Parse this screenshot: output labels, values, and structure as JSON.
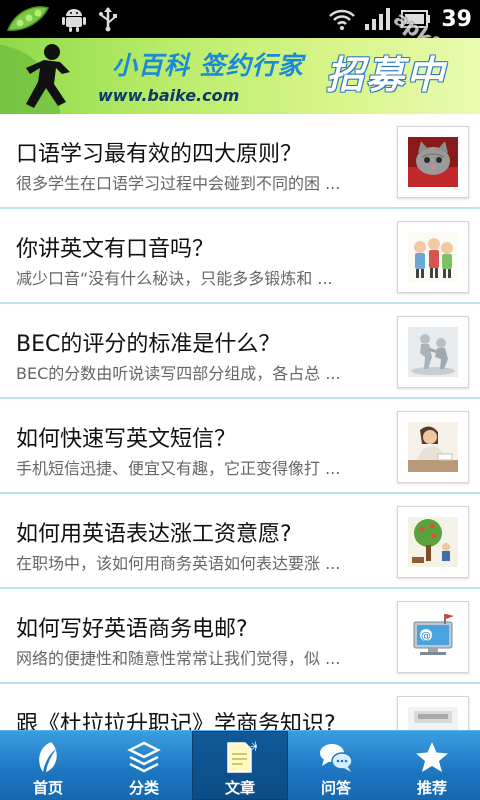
{
  "status_bar": {
    "time": "39",
    "watermark": "apk8.com",
    "icons": [
      "pea-pod-icon",
      "android-icon",
      "usb-icon",
      "wifi-icon",
      "signal-icon",
      "battery-icon"
    ]
  },
  "banner": {
    "slogan": "小百科 签约行家",
    "url": "www.baike.com",
    "recruit": "招募中"
  },
  "articles": [
    {
      "title": "口语学习最有效的四大原则？",
      "summary": "很多学生在口语学习过程中会碰到不同的困 ...",
      "thumb_icon": "kitten-thumb"
    },
    {
      "title": "你讲英文有口音吗？",
      "summary": "减少口音“没有什么秘诀，只能多多锻炼和 ...",
      "thumb_icon": "cartoon-people-thumb"
    },
    {
      "title": "BEC的评分的标准是什么？",
      "summary": "BEC的分数由听说读写四部分组成，各占总 ...",
      "thumb_icon": "figures-thumb"
    },
    {
      "title": "如何快速写英文短信？",
      "summary": "手机短信迅捷、便宜又有趣，它正变得像打 ...",
      "thumb_icon": "woman-desk-thumb"
    },
    {
      "title": "如何用英语表达涨工资意愿?",
      "summary": "在职场中，该如何用商务英语如何表达要涨 ...",
      "thumb_icon": "money-tree-thumb"
    },
    {
      "title": "如何写好英语商务电邮?",
      "summary": "网络的便捷性和随意性常常让我们觉得，似 ...",
      "thumb_icon": "email-computer-thumb"
    },
    {
      "title": "跟《杜拉拉升职记》学商务知识?",
      "summary": "",
      "thumb_icon": "book-cover-thumb"
    }
  ],
  "tabs": [
    {
      "label": "首页",
      "icon": "leaf-icon",
      "active": false
    },
    {
      "label": "分类",
      "icon": "layers-icon",
      "active": false
    },
    {
      "label": "文章",
      "icon": "article-icon",
      "active": true
    },
    {
      "label": "问答",
      "icon": "chat-bubbles-icon",
      "active": false
    },
    {
      "label": "推荐",
      "icon": "star-icon",
      "active": false
    }
  ],
  "colors": {
    "tab_bar": "#1f78c3",
    "tab_active": "#0c4c85",
    "divider": "#b9e3f2",
    "banner_green": "#b9ec6a",
    "slogan_blue": "#1a8ad6"
  }
}
